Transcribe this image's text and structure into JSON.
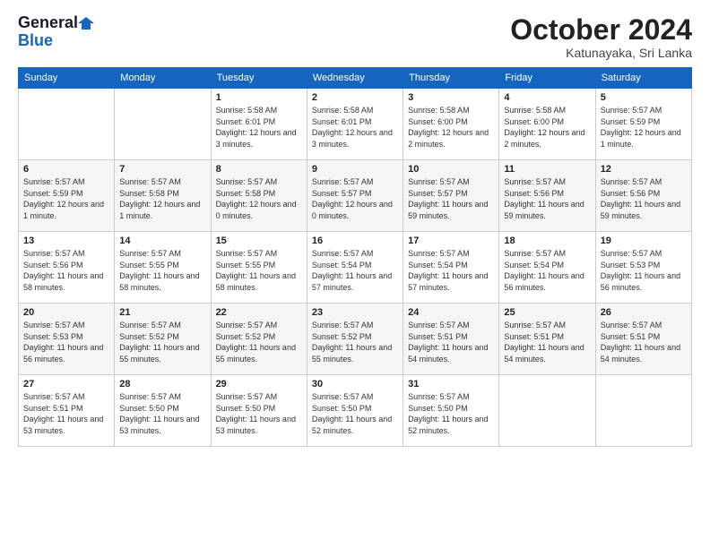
{
  "logo": {
    "line1": "General",
    "line2": "Blue"
  },
  "header": {
    "month": "October 2024",
    "location": "Katunayaka, Sri Lanka"
  },
  "weekdays": [
    "Sunday",
    "Monday",
    "Tuesday",
    "Wednesday",
    "Thursday",
    "Friday",
    "Saturday"
  ],
  "weeks": [
    [
      {
        "day": "",
        "info": ""
      },
      {
        "day": "",
        "info": ""
      },
      {
        "day": "1",
        "sunrise": "5:58 AM",
        "sunset": "6:01 PM",
        "daylight": "12 hours and 3 minutes."
      },
      {
        "day": "2",
        "sunrise": "5:58 AM",
        "sunset": "6:01 PM",
        "daylight": "12 hours and 3 minutes."
      },
      {
        "day": "3",
        "sunrise": "5:58 AM",
        "sunset": "6:00 PM",
        "daylight": "12 hours and 2 minutes."
      },
      {
        "day": "4",
        "sunrise": "5:58 AM",
        "sunset": "6:00 PM",
        "daylight": "12 hours and 2 minutes."
      },
      {
        "day": "5",
        "sunrise": "5:57 AM",
        "sunset": "5:59 PM",
        "daylight": "12 hours and 1 minute."
      }
    ],
    [
      {
        "day": "6",
        "sunrise": "5:57 AM",
        "sunset": "5:59 PM",
        "daylight": "12 hours and 1 minute."
      },
      {
        "day": "7",
        "sunrise": "5:57 AM",
        "sunset": "5:58 PM",
        "daylight": "12 hours and 1 minute."
      },
      {
        "day": "8",
        "sunrise": "5:57 AM",
        "sunset": "5:58 PM",
        "daylight": "12 hours and 0 minutes."
      },
      {
        "day": "9",
        "sunrise": "5:57 AM",
        "sunset": "5:57 PM",
        "daylight": "12 hours and 0 minutes."
      },
      {
        "day": "10",
        "sunrise": "5:57 AM",
        "sunset": "5:57 PM",
        "daylight": "11 hours and 59 minutes."
      },
      {
        "day": "11",
        "sunrise": "5:57 AM",
        "sunset": "5:56 PM",
        "daylight": "11 hours and 59 minutes."
      },
      {
        "day": "12",
        "sunrise": "5:57 AM",
        "sunset": "5:56 PM",
        "daylight": "11 hours and 59 minutes."
      }
    ],
    [
      {
        "day": "13",
        "sunrise": "5:57 AM",
        "sunset": "5:56 PM",
        "daylight": "11 hours and 58 minutes."
      },
      {
        "day": "14",
        "sunrise": "5:57 AM",
        "sunset": "5:55 PM",
        "daylight": "11 hours and 58 minutes."
      },
      {
        "day": "15",
        "sunrise": "5:57 AM",
        "sunset": "5:55 PM",
        "daylight": "11 hours and 58 minutes."
      },
      {
        "day": "16",
        "sunrise": "5:57 AM",
        "sunset": "5:54 PM",
        "daylight": "11 hours and 57 minutes."
      },
      {
        "day": "17",
        "sunrise": "5:57 AM",
        "sunset": "5:54 PM",
        "daylight": "11 hours and 57 minutes."
      },
      {
        "day": "18",
        "sunrise": "5:57 AM",
        "sunset": "5:54 PM",
        "daylight": "11 hours and 56 minutes."
      },
      {
        "day": "19",
        "sunrise": "5:57 AM",
        "sunset": "5:53 PM",
        "daylight": "11 hours and 56 minutes."
      }
    ],
    [
      {
        "day": "20",
        "sunrise": "5:57 AM",
        "sunset": "5:53 PM",
        "daylight": "11 hours and 56 minutes."
      },
      {
        "day": "21",
        "sunrise": "5:57 AM",
        "sunset": "5:52 PM",
        "daylight": "11 hours and 55 minutes."
      },
      {
        "day": "22",
        "sunrise": "5:57 AM",
        "sunset": "5:52 PM",
        "daylight": "11 hours and 55 minutes."
      },
      {
        "day": "23",
        "sunrise": "5:57 AM",
        "sunset": "5:52 PM",
        "daylight": "11 hours and 55 minutes."
      },
      {
        "day": "24",
        "sunrise": "5:57 AM",
        "sunset": "5:51 PM",
        "daylight": "11 hours and 54 minutes."
      },
      {
        "day": "25",
        "sunrise": "5:57 AM",
        "sunset": "5:51 PM",
        "daylight": "11 hours and 54 minutes."
      },
      {
        "day": "26",
        "sunrise": "5:57 AM",
        "sunset": "5:51 PM",
        "daylight": "11 hours and 54 minutes."
      }
    ],
    [
      {
        "day": "27",
        "sunrise": "5:57 AM",
        "sunset": "5:51 PM",
        "daylight": "11 hours and 53 minutes."
      },
      {
        "day": "28",
        "sunrise": "5:57 AM",
        "sunset": "5:50 PM",
        "daylight": "11 hours and 53 minutes."
      },
      {
        "day": "29",
        "sunrise": "5:57 AM",
        "sunset": "5:50 PM",
        "daylight": "11 hours and 53 minutes."
      },
      {
        "day": "30",
        "sunrise": "5:57 AM",
        "sunset": "5:50 PM",
        "daylight": "11 hours and 52 minutes."
      },
      {
        "day": "31",
        "sunrise": "5:57 AM",
        "sunset": "5:50 PM",
        "daylight": "11 hours and 52 minutes."
      },
      {
        "day": "",
        "info": ""
      },
      {
        "day": "",
        "info": ""
      }
    ]
  ]
}
